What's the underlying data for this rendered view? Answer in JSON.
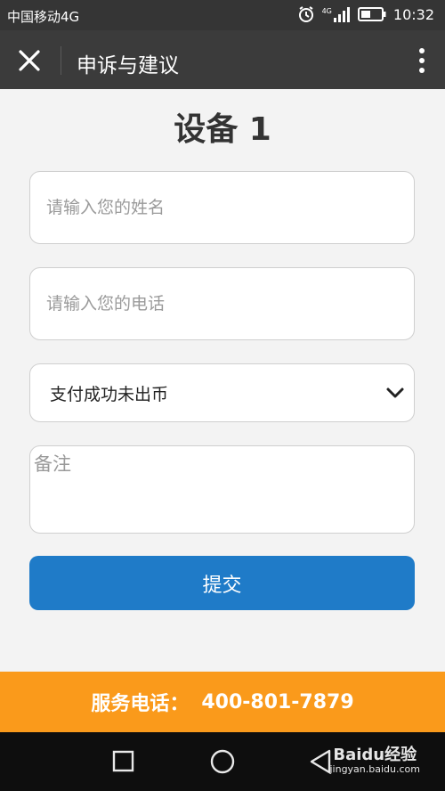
{
  "status_bar": {
    "carrier": "中国移动4G",
    "network_badge": "4G",
    "time": "10:32",
    "icons": [
      "alarm-icon",
      "signal-icon",
      "battery-icon"
    ]
  },
  "app_bar": {
    "title": "申诉与建议",
    "icons": [
      "close-icon",
      "more-vertical-icon"
    ]
  },
  "page_title": "设备 1",
  "form": {
    "name_placeholder": "请输入您的姓名",
    "phone_placeholder": "请输入您的电话",
    "issue_select_value": "支付成功未出币",
    "remarks_placeholder": "备注",
    "submit_label": "提交"
  },
  "service_bar": {
    "label": "服务电话：",
    "phone": "400-801-7879"
  },
  "nav_bar": {
    "icons": [
      "recent-apps-icon",
      "home-icon",
      "back-icon"
    ]
  },
  "watermark": {
    "brand": "Baidu经验",
    "domain": "jingyan.baidu.com"
  },
  "colors": {
    "status_bar": "#353535",
    "app_bar": "#3b3b3b",
    "primary_button": "#1f7bc8",
    "service_bar": "#fa9a1b",
    "nav_bar": "#0e0e0e"
  }
}
